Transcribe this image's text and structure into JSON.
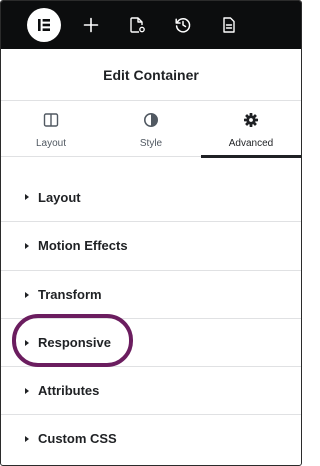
{
  "toolbar": {
    "logo_icon": "elementor-logo-icon",
    "items": [
      {
        "icon": "plus-icon"
      },
      {
        "icon": "page-settings-icon"
      },
      {
        "icon": "history-icon"
      },
      {
        "icon": "document-icon"
      }
    ]
  },
  "header": {
    "title": "Edit Container"
  },
  "tabs": [
    {
      "label": "Layout",
      "icon": "layout-columns-icon"
    },
    {
      "label": "Style",
      "icon": "half-circle-icon"
    },
    {
      "label": "Advanced",
      "icon": "gear-icon",
      "active": true
    }
  ],
  "sections": [
    {
      "label": "Layout"
    },
    {
      "label": "Motion Effects"
    },
    {
      "label": "Transform"
    },
    {
      "label": "Responsive",
      "highlighted": true
    },
    {
      "label": "Attributes"
    },
    {
      "label": "Custom CSS"
    }
  ],
  "colors": {
    "toolbar_bg": "#0c0d0e",
    "highlight_ring": "#6b1d5f",
    "text": "#1f2124"
  }
}
